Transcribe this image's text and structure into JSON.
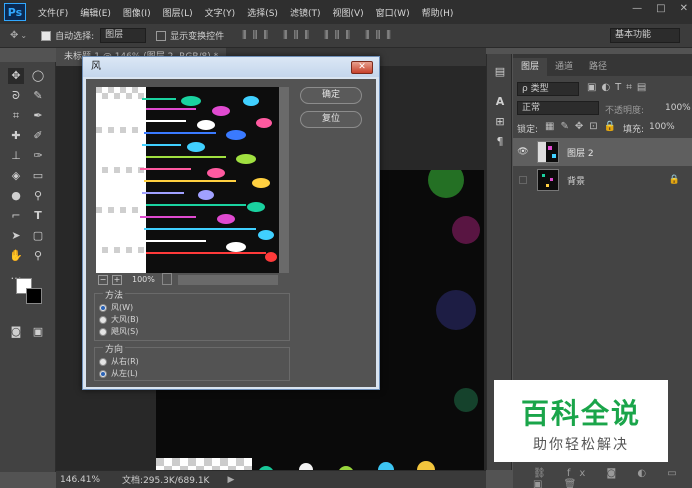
{
  "app": {
    "logo": "Ps"
  },
  "menu": [
    "文件(F)",
    "编辑(E)",
    "图像(I)",
    "图层(L)",
    "文字(Y)",
    "选择(S)",
    "滤镜(T)",
    "视图(V)",
    "窗口(W)",
    "帮助(H)"
  ],
  "window_controls": {
    "minimize": "—",
    "maximize": "□",
    "close": "✕"
  },
  "options": {
    "auto_select_label": "自动选择:",
    "auto_select_value": "图层",
    "show_transform_label": "显示变换控件",
    "workspace": "基本功能"
  },
  "document_tab": {
    "label": "未标题-1 @ 146% (图层 2, RGB/8) *"
  },
  "status": {
    "zoom": "146.41%",
    "doc_info": "文档:295.3K/689.1K"
  },
  "panel_tabs": [
    "图层",
    "通道",
    "路径"
  ],
  "layers_panel": {
    "filter_label": "ρ 类型",
    "blend_mode": "正常",
    "opacity_label": "不透明度:",
    "opacity_value": "100%",
    "lock_label": "锁定:",
    "fill_label": "填充:",
    "fill_value": "100%",
    "layers": [
      {
        "name": "图层 2",
        "selected": true,
        "visible": true
      },
      {
        "name": "背景",
        "selected": false,
        "visible": false,
        "locked": true
      }
    ]
  },
  "dialog": {
    "title": "风",
    "ok_label": "确定",
    "reset_label": "复位",
    "zoom_label": "100%",
    "method": {
      "title": "方法",
      "options": [
        "风(W)",
        "大风(B)",
        "飓风(S)"
      ],
      "selected": 0
    },
    "direction": {
      "title": "方向",
      "options": [
        "从右(R)",
        "从左(L)"
      ],
      "selected": 1
    }
  },
  "watermark": {
    "title": "百科全说",
    "subtitle": "助你轻松解决"
  },
  "colors": {
    "accent_blue": "#31a8ff",
    "watermark_green": "#1aa54a",
    "dialog_frame": "#d9e4f0"
  }
}
